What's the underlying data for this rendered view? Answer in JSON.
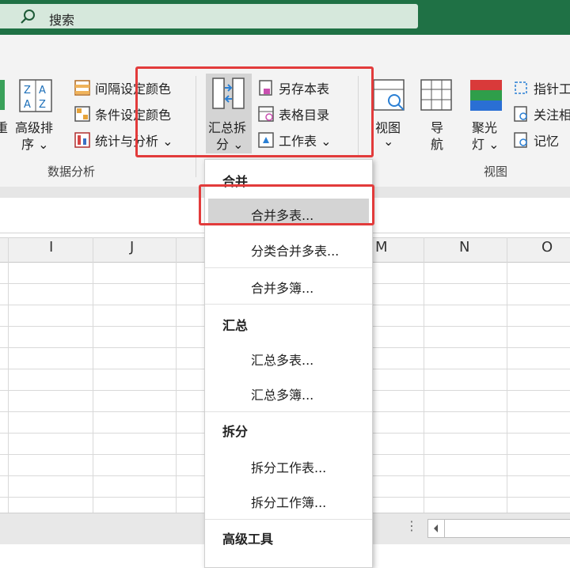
{
  "search": {
    "placeholder": "搜索",
    "icon": "search-icon"
  },
  "ribbon": {
    "sort_group": {
      "cut_label": "重",
      "advanced_sort_line1": "高级排",
      "advanced_sort_line2": "序 ⌄"
    },
    "color_items": [
      {
        "label": "间隔设定颜色",
        "icon": "interval-color-icon"
      },
      {
        "label": "条件设定颜色",
        "icon": "condition-color-icon"
      },
      {
        "label": "统计与分析 ⌄",
        "icon": "statistics-icon"
      }
    ],
    "data_analysis_label": "数据分析",
    "summary_split": {
      "line1": "汇总拆",
      "line2": "分 ⌄",
      "icon": "summary-split-icon"
    },
    "sheet_items": [
      {
        "label": "另存本表",
        "icon": "save-sheet-icon"
      },
      {
        "label": "表格目录",
        "icon": "table-directory-icon"
      },
      {
        "label": "工作表 ⌄",
        "icon": "worksheet-icon"
      }
    ],
    "view_buttons": [
      {
        "line1": "视图",
        "line2": "⌄",
        "icon": "view-icon"
      },
      {
        "line1": "导",
        "line2": "航",
        "icon": "navigation-icon"
      },
      {
        "line1": "聚光",
        "line2": "灯 ⌄",
        "icon": "spotlight-icon"
      }
    ],
    "right_items": [
      {
        "label": "指针工",
        "icon": "pointer-tool-icon"
      },
      {
        "label": "关注相",
        "icon": "focus-icon"
      },
      {
        "label": "记忆",
        "icon": "memory-icon"
      }
    ],
    "view_label": "视图"
  },
  "sheet": {
    "columns_left": [
      "I",
      "J"
    ],
    "columns_right": [
      "M",
      "N",
      "O"
    ]
  },
  "menu": {
    "sections": [
      {
        "title": "合并",
        "items": [
          "合并多表...",
          "分类合并多表...",
          "合并多簿..."
        ]
      },
      {
        "title": "汇总",
        "items": [
          "汇总多表...",
          "汇总多簿..."
        ]
      },
      {
        "title": "拆分",
        "items": [
          "拆分工作表...",
          "拆分工作簿..."
        ]
      },
      {
        "title": "高级工具",
        "items": []
      }
    ],
    "highlighted_item": "合并多表..."
  },
  "colors": {
    "titlebar": "#1f7145",
    "ribbon_bg": "#f3f3f3",
    "highlight_red": "#e23b3b",
    "menu_hover": "#d4d4d4"
  }
}
